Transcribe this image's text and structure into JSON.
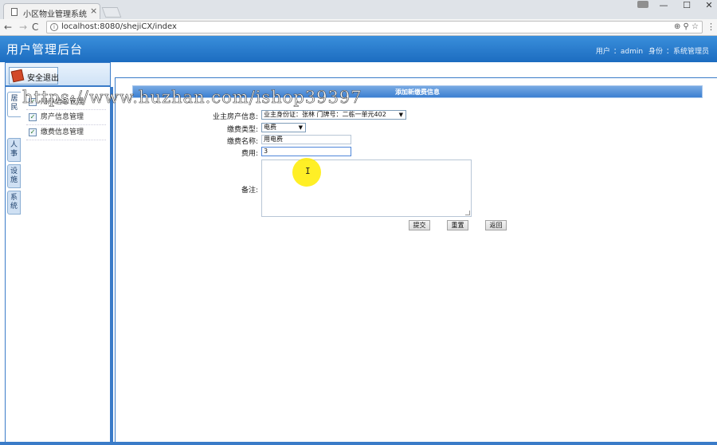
{
  "browser": {
    "tab_title": "小区物业管理系统",
    "tab_close": "×",
    "url": "localhost:8080/shejiCX/index",
    "win_min": "—",
    "win_max": "☐",
    "win_close": "✕",
    "nav_back": "←",
    "nav_forward": "→",
    "nav_reload": "C",
    "omni_icons": "⊕ ⚲ ☆",
    "menu_dots": "⋮",
    "url_icon": "i"
  },
  "header": {
    "title": "用户管理后台",
    "user_label": "用户",
    "user_value": "：admin",
    "role_label": "身份",
    "role_value": "：系统管理员"
  },
  "watermark": "https://www.huzhan.com/ishop39397",
  "sidebar": {
    "logout_label": "安全退出",
    "vtabs": [
      "居民",
      "人事",
      "设施",
      "系统"
    ],
    "menu_items": [
      {
        "label": "用户信息管理"
      },
      {
        "label": "房产信息管理"
      },
      {
        "label": "缴费信息管理"
      }
    ]
  },
  "form": {
    "title": "添加新缴费信息",
    "fields": {
      "property_label": "业主房产信息:",
      "property_value": "业主身份证：张林    门牌号：二栋一单元402",
      "fee_type_label": "缴费类型:",
      "fee_type_value": "电费",
      "fee_name_label": "缴费名称:",
      "fee_name_value": "用电费",
      "amount_label": "费用:",
      "amount_value": "3",
      "remark_label": "备注:",
      "remark_value": ""
    },
    "buttons": {
      "submit": "提交",
      "reset": "重置",
      "back": "返回"
    }
  },
  "icons": {
    "dropdown": "▼",
    "cursor": "I"
  },
  "colors": {
    "header_blue": "#1c6cc0",
    "accent_blue": "#3a7bc8",
    "cursor_highlight": "#ffec00"
  }
}
